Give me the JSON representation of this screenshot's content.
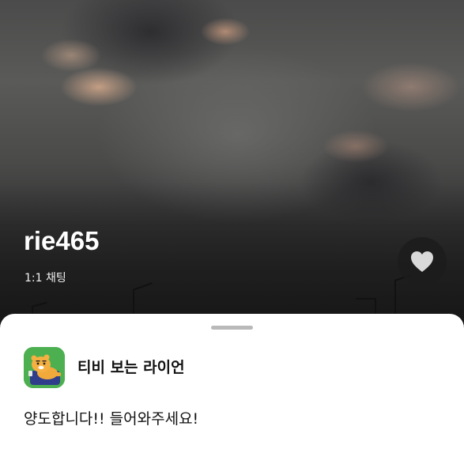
{
  "hero": {
    "background_image": "cloudy-sky-photo",
    "username": "rie465",
    "chat_type": "1:1 채팅",
    "like_icon": "heart-icon"
  },
  "sheet": {
    "handle": "drag-handle",
    "chat_name": "티비 보는 라이언",
    "avatar_icon": "ryan-character-avatar",
    "message": "양도합니다!! 들어와주세요!"
  },
  "colors": {
    "sheet_background": "#ffffff",
    "text": "#111111",
    "avatar_green": "#4caf50",
    "heart": "#d9d9d9"
  }
}
